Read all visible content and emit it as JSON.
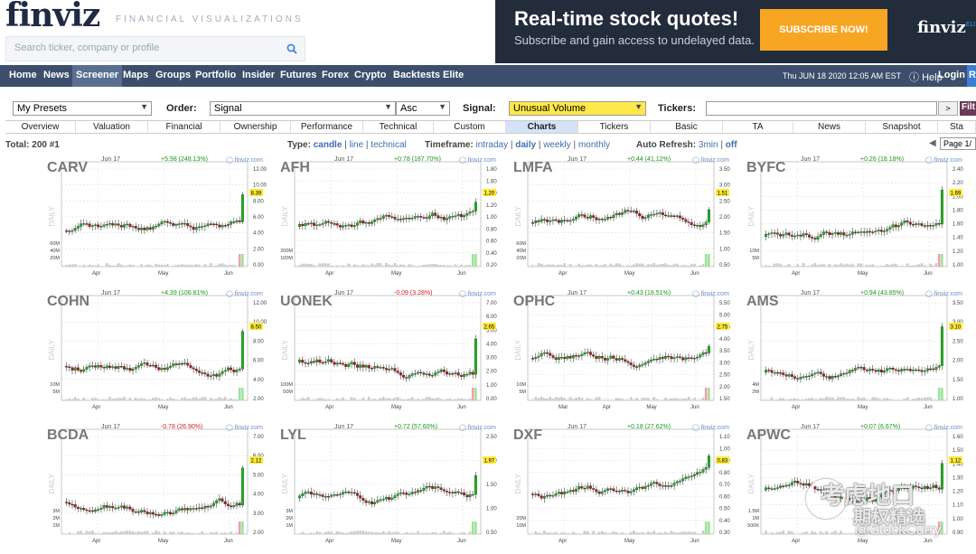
{
  "header": {
    "logo": "finviz",
    "tagline": "FINANCIAL VISUALIZATIONS",
    "search_placeholder": "Search ticker, company or profile"
  },
  "banner": {
    "title": "Real-time stock quotes!",
    "subtitle": "Subscribe and gain access to undelayed data.",
    "button": "SUBSCRIBE NOW!",
    "logo": "finviz",
    "logo_small": "ELI"
  },
  "nav": {
    "items": [
      "Home",
      "News",
      "Screener",
      "Maps",
      "Groups",
      "Portfolio",
      "Insider",
      "Futures",
      "Forex",
      "Crypto",
      "Backtests",
      "Elite"
    ],
    "active": "Screener",
    "datetime": "Thu JUN 18 2020 12:05 AM EST",
    "help": "Help",
    "login": "Login",
    "register": "R"
  },
  "filters": {
    "presets": "My Presets",
    "order_label": "Order:",
    "order": "Signal",
    "direction": "Asc",
    "signal_label": "Signal:",
    "signal": "Unusual Volume",
    "tickers_label": "Tickers:",
    "tickers_value": "",
    "go": ">",
    "filter_btn": "Filt"
  },
  "tabs": [
    "Overview",
    "Valuation",
    "Financial",
    "Ownership",
    "Performance",
    "Technical",
    "Custom",
    "Charts",
    "Tickers",
    "Basic",
    "TA",
    "News",
    "Snapshot",
    "Sta"
  ],
  "active_tab": "Charts",
  "info": {
    "total": "Total: 200 #1",
    "type_label": "Type:",
    "type_candle": "candle",
    "type_line": "line",
    "type_technical": "technical",
    "timeframe_label": "Timeframe:",
    "tf_intraday": "intraday",
    "tf_daily": "daily",
    "tf_weekly": "weekly",
    "tf_monthly": "monthly",
    "refresh_label": "Auto Refresh:",
    "refresh_3min": "3min",
    "refresh_off": "off",
    "page": "Page 1/"
  },
  "charts": [
    {
      "ticker": "CARV",
      "date": "Jun 17",
      "change": "+5.98 (248.13%)",
      "dir": "up",
      "brand": "finviz.com",
      "label": "DAILY",
      "last": "8.39",
      "yticks": [
        "12.00",
        "10.00",
        "8.00",
        "6.00",
        "4.00",
        "2.00",
        "0.00"
      ],
      "vticks": [
        "60M",
        "40M",
        "20M"
      ],
      "xticks": [
        "Apr",
        "May",
        "Jun"
      ]
    },
    {
      "ticker": "AFH",
      "date": "Jun 17",
      "change": "+0.78 (187.70%)",
      "dir": "up",
      "brand": "finviz.com",
      "label": "DAILY",
      "last": "1.20",
      "yticks": [
        "1.80",
        "1.60",
        "1.40",
        "1.20",
        "1.00",
        "0.80",
        "0.60",
        "0.40",
        "0.20"
      ],
      "vticks": [
        "200M",
        "100M"
      ],
      "xticks": [
        "Apr",
        "May",
        "Jun"
      ]
    },
    {
      "ticker": "LMFA",
      "date": "Jun 17",
      "change": "+0.44 (41.12%)",
      "dir": "up",
      "brand": "finviz.com",
      "label": "DAILY",
      "last": "1.51",
      "yticks": [
        "3.50",
        "3.00",
        "2.50",
        "2.00",
        "1.50",
        "1.00",
        "0.50"
      ],
      "vticks": [
        "60M",
        "40M",
        "20M"
      ],
      "xticks": [
        "Apr",
        "May",
        "Jun"
      ]
    },
    {
      "ticker": "BYFC",
      "date": "Jun 17",
      "change": "+0.26 (18.18%)",
      "dir": "up",
      "brand": "finviz.com",
      "label": "DAILY",
      "last": "1.69",
      "yticks": [
        "2.40",
        "2.20",
        "2.00",
        "1.80",
        "1.60",
        "1.40",
        "1.20",
        "1.00"
      ],
      "vticks": [
        "10M",
        "5M"
      ],
      "xticks": [
        "Apr",
        "May",
        "Jun"
      ]
    },
    {
      "ticker": "COHN",
      "date": "Jun 17",
      "change": "+4.39 (106.81%)",
      "dir": "up",
      "brand": "finviz.com",
      "label": "DAILY",
      "last": "8.50",
      "yticks": [
        "12.00",
        "10.00",
        "8.00",
        "6.00",
        "4.00",
        "2.00"
      ],
      "vticks": [
        "10M",
        "5M"
      ],
      "xticks": [
        "Apr",
        "May",
        "Jun"
      ]
    },
    {
      "ticker": "UONEK",
      "date": "Jun 17",
      "change": "-0.09 (3.28%)",
      "dir": "dn",
      "brand": "finviz.com",
      "label": "DAILY",
      "last": "2.65",
      "yticks": [
        "7.00",
        "6.00",
        "5.00",
        "4.00",
        "3.00",
        "2.00",
        "1.00",
        "0.00"
      ],
      "vticks": [
        "100M",
        "50M"
      ],
      "xticks": [
        "Apr",
        "May",
        "Jun"
      ]
    },
    {
      "ticker": "OPHC",
      "date": "Jun 17",
      "change": "+0.43 (18.51%)",
      "dir": "up",
      "brand": "finviz.com",
      "label": "DAILY",
      "last": "2.75",
      "yticks": [
        "5.50",
        "5.00",
        "4.50",
        "4.00",
        "3.50",
        "3.00",
        "2.50",
        "2.00",
        "1.50"
      ],
      "vticks": [
        "10M",
        "5M"
      ],
      "xticks": [
        "Mar",
        "Apr",
        "May",
        "Jun"
      ]
    },
    {
      "ticker": "AMS",
      "date": "Jun 17",
      "change": "+0.94 (43.85%)",
      "dir": "up",
      "brand": "finviz.com",
      "label": "DAILY",
      "last": "3.10",
      "yticks": [
        "3.50",
        "3.00",
        "2.50",
        "2.00",
        "1.50",
        "1.00"
      ],
      "vticks": [
        "4M",
        "2M"
      ],
      "xticks": [
        "Apr",
        "May",
        "Jun"
      ]
    },
    {
      "ticker": "BCDA",
      "date": "Jun 17",
      "change": "-0.78 (26.90%)",
      "dir": "dn",
      "brand": "finviz.com",
      "label": "DAILY",
      "last": "2.12",
      "yticks": [
        "7.00",
        "6.00",
        "5.00",
        "4.00",
        "3.00",
        "2.00"
      ],
      "vticks": [
        "3M",
        "2M",
        "1M"
      ],
      "xticks": [
        "Apr",
        "May",
        "Jun"
      ]
    },
    {
      "ticker": "LYL",
      "date": "Jun 17",
      "change": "+0.72 (57.60%)",
      "dir": "up",
      "brand": "finviz.com",
      "label": "DAILY",
      "last": "1.97",
      "yticks": [
        "2.50",
        "2.00",
        "1.50",
        "1.00",
        "0.50"
      ],
      "vticks": [
        "3M",
        "2M",
        "1M"
      ],
      "xticks": [
        "Apr",
        "May",
        "Jun"
      ]
    },
    {
      "ticker": "DXF",
      "date": "Jun 17",
      "change": "+0.18 (27.62%)",
      "dir": "up",
      "brand": "finviz.com",
      "label": "DAILY",
      "last": "0.83",
      "yticks": [
        "1.10",
        "1.00",
        "0.90",
        "0.80",
        "0.70",
        "0.60",
        "0.50",
        "0.40",
        "0.30"
      ],
      "vticks": [
        "20M",
        "10M"
      ],
      "xticks": [
        "Apr",
        "May",
        "Jun"
      ]
    },
    {
      "ticker": "APWC",
      "date": "Jun 17",
      "change": "+0.07 (6.67%)",
      "dir": "up",
      "brand": "finviz.com",
      "label": "DAILY",
      "last": "1.12",
      "yticks": [
        "1.60",
        "1.50",
        "1.40",
        "1.30",
        "1.20",
        "1.10",
        "1.00",
        "0.90"
      ],
      "vticks": [
        "1.5M",
        "1M",
        "500K"
      ],
      "xticks": [
        "Apr",
        "May",
        "Jun"
      ]
    }
  ],
  "watermark": {
    "line1": "考虑地口",
    "line2": "期权精选",
    "line3": "@StockCurry"
  }
}
